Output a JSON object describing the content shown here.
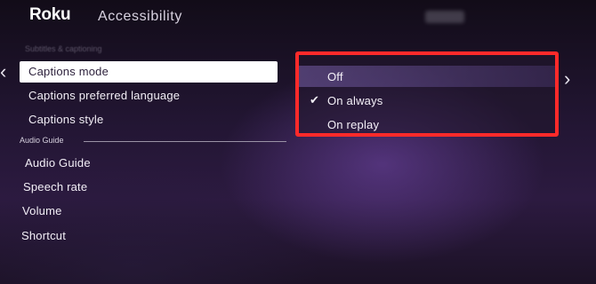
{
  "header": {
    "logo": "Roku",
    "title": "Accessibility"
  },
  "captions_section_label": "Subtitles & captioning",
  "menu": {
    "items": [
      {
        "label": "Captions mode",
        "selected": true
      },
      {
        "label": "Captions preferred language",
        "selected": false
      },
      {
        "label": "Captions style",
        "selected": false
      }
    ],
    "audio_guide_section_label": "Audio Guide",
    "audio_items": [
      {
        "label": "Audio Guide"
      },
      {
        "label": "Speech rate"
      },
      {
        "label": "Volume"
      },
      {
        "label": "Shortcut"
      }
    ]
  },
  "nav": {
    "left_glyph": "‹",
    "right_glyph": "›"
  },
  "dropdown": {
    "highlight_color": "#ff2a2a",
    "options": [
      {
        "label": "Off",
        "checked": false,
        "focused": true
      },
      {
        "label": "On always",
        "checked": true,
        "focused": false
      },
      {
        "label": "On replay",
        "checked": false,
        "focused": false
      }
    ],
    "check_glyph": "✔"
  },
  "icons": {
    "back": "chevron-left-icon",
    "forward": "chevron-right-icon",
    "check": "checkmark-icon"
  }
}
